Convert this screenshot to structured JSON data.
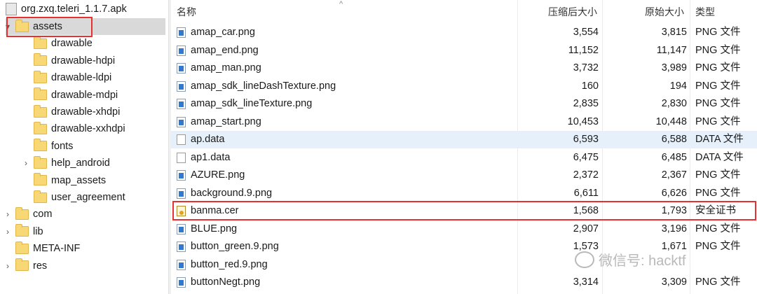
{
  "tree": {
    "root": "org.zxq.teleri_1.1.7.apk",
    "items": [
      {
        "label": "assets",
        "expander": "▾"
      },
      {
        "label": "drawable",
        "expander": ""
      },
      {
        "label": "drawable-hdpi",
        "expander": ""
      },
      {
        "label": "drawable-ldpi",
        "expander": ""
      },
      {
        "label": "drawable-mdpi",
        "expander": ""
      },
      {
        "label": "drawable-xhdpi",
        "expander": ""
      },
      {
        "label": "drawable-xxhdpi",
        "expander": ""
      },
      {
        "label": "fonts",
        "expander": ""
      },
      {
        "label": "help_android",
        "expander": "›"
      },
      {
        "label": "map_assets",
        "expander": ""
      },
      {
        "label": "user_agreement",
        "expander": ""
      },
      {
        "label": "com",
        "expander": "›"
      },
      {
        "label": "lib",
        "expander": "›"
      },
      {
        "label": "META-INF",
        "expander": ""
      },
      {
        "label": "res",
        "expander": "›"
      }
    ]
  },
  "columns": {
    "name": "名称",
    "compressed": "压缩后大小",
    "original": "原始大小",
    "type": "类型",
    "sort_indicator": "^"
  },
  "files": [
    {
      "name": "amap_car.png",
      "compressed": "3,554",
      "original": "3,815",
      "type": "PNG 文件",
      "icon": "png-file-icon"
    },
    {
      "name": "amap_end.png",
      "compressed": "11,152",
      "original": "11,147",
      "type": "PNG 文件",
      "icon": "png-file-icon"
    },
    {
      "name": "amap_man.png",
      "compressed": "3,732",
      "original": "3,989",
      "type": "PNG 文件",
      "icon": "png-file-icon"
    },
    {
      "name": "amap_sdk_lineDashTexture.png",
      "compressed": "160",
      "original": "194",
      "type": "PNG 文件",
      "icon": "png-file-icon"
    },
    {
      "name": "amap_sdk_lineTexture.png",
      "compressed": "2,835",
      "original": "2,830",
      "type": "PNG 文件",
      "icon": "png-file-icon"
    },
    {
      "name": "amap_start.png",
      "compressed": "10,453",
      "original": "10,448",
      "type": "PNG 文件",
      "icon": "png-file-icon"
    },
    {
      "name": "ap.data",
      "compressed": "6,593",
      "original": "6,588",
      "type": "DATA 文件",
      "icon": "data-file-icon"
    },
    {
      "name": "ap1.data",
      "compressed": "6,475",
      "original": "6,485",
      "type": "DATA 文件",
      "icon": "data-file-icon"
    },
    {
      "name": "AZURE.png",
      "compressed": "2,372",
      "original": "2,367",
      "type": "PNG 文件",
      "icon": "png-file-icon"
    },
    {
      "name": "background.9.png",
      "compressed": "6,611",
      "original": "6,626",
      "type": "PNG 文件",
      "icon": "png-file-icon"
    },
    {
      "name": "banma.cer",
      "compressed": "1,568",
      "original": "1,793",
      "type": "安全证书",
      "icon": "certificate-file-icon"
    },
    {
      "name": "BLUE.png",
      "compressed": "2,907",
      "original": "3,196",
      "type": "PNG 文件",
      "icon": "png-file-icon"
    },
    {
      "name": "button_green.9.png",
      "compressed": "1,573",
      "original": "1,671",
      "type": "PNG 文件",
      "icon": "png-file-icon"
    },
    {
      "name": "button_red.9.png",
      "compressed": "",
      "original": "",
      "type": "",
      "icon": "png-file-icon"
    },
    {
      "name": "buttonNegt.png",
      "compressed": "3,314",
      "original": "3,309",
      "type": "PNG 文件",
      "icon": "png-file-icon"
    }
  ],
  "watermark": "微信号: hacktf",
  "colors": {
    "highlight_box": "#e8312f",
    "selected_row": "#d9d9d9",
    "hover_row": "#e6f0fb"
  }
}
